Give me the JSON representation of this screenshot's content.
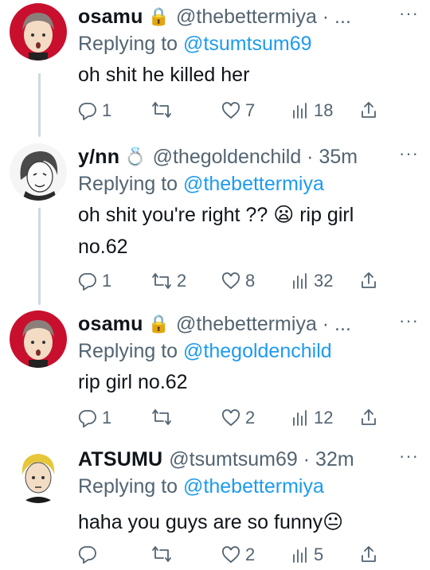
{
  "tweets": [
    {
      "name": "osamu",
      "badge": "🔒",
      "handle": "@thebettermiya · ...",
      "replying_prefix": "Replying to ",
      "replying_to": "@tsumtsum69",
      "text": "oh shit he killed her",
      "counts": {
        "reply": "1",
        "retweet": "",
        "like": "7",
        "views": "18"
      }
    },
    {
      "name": "y/nn",
      "badge": "💍",
      "handle": "@thegoldenchild · 35m",
      "replying_prefix": "Replying to ",
      "replying_to": "@thebettermiya",
      "text": "oh shit you're right ?? 😦 rip girl no.62",
      "counts": {
        "reply": "1",
        "retweet": "2",
        "like": "8",
        "views": "32"
      }
    },
    {
      "name": "osamu",
      "badge": "🔒",
      "handle": "@thebettermiya · ...",
      "replying_prefix": "Replying to ",
      "replying_to": "@thegoldenchild",
      "text": "rip girl no.62",
      "counts": {
        "reply": "1",
        "retweet": "",
        "like": "2",
        "views": "12"
      }
    },
    {
      "name": "ATSUMU",
      "badge": "",
      "handle": "@tsumtsum69 · 32m",
      "replying_prefix": "Replying to ",
      "replying_to": "@thebettermiya",
      "text": "haha you guys are so funny😐",
      "counts": {
        "reply": "",
        "retweet": "",
        "like": "2",
        "views": "5"
      }
    }
  ],
  "more_label": "···",
  "colors": {
    "link": "#1d9bf0",
    "muted": "#536471",
    "thread_line": "#cfd9de",
    "avatar_red": "#c8102e"
  },
  "icons": {
    "reply": "speech-bubble-icon",
    "retweet": "retweet-icon",
    "like": "heart-icon",
    "views": "bar-chart-icon",
    "share": "share-icon"
  }
}
